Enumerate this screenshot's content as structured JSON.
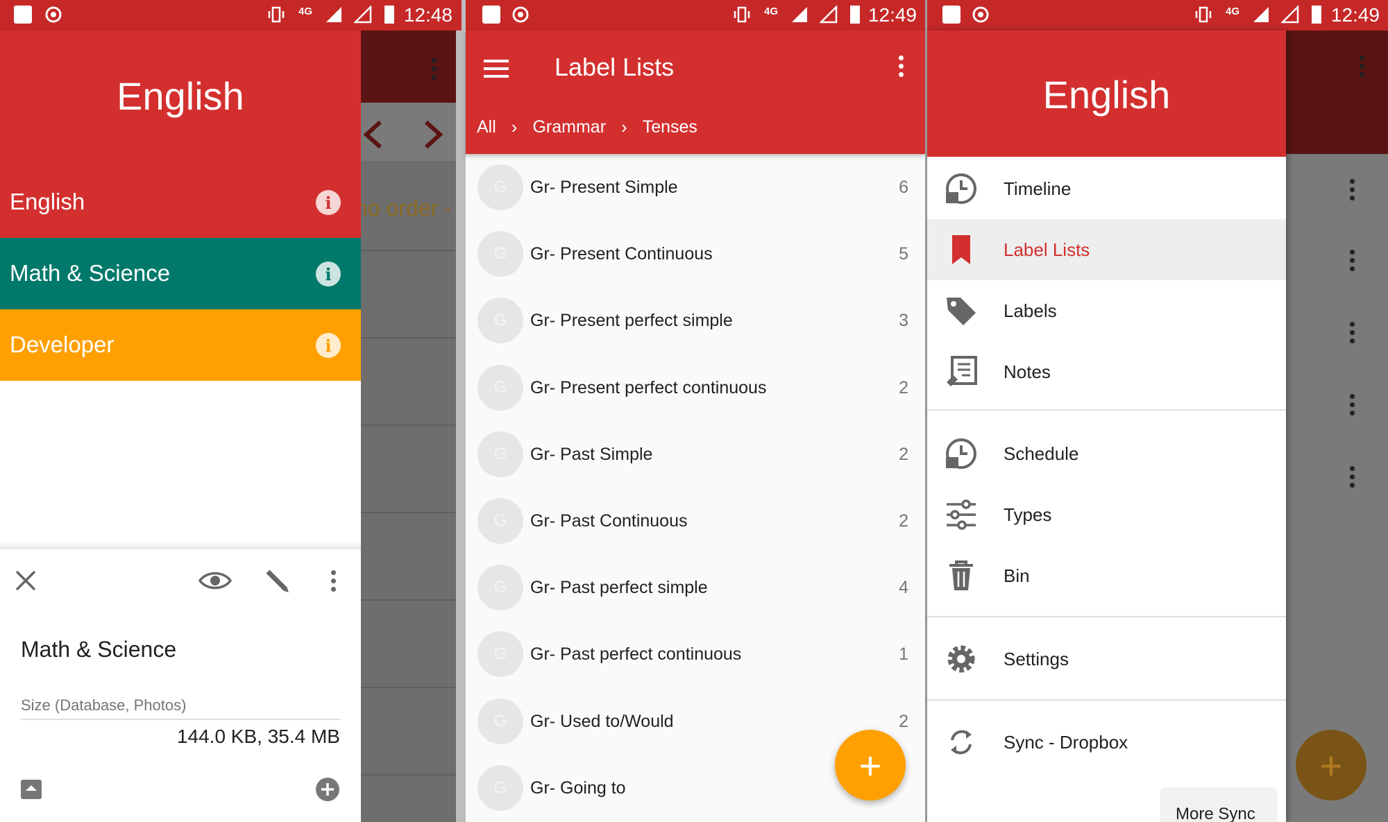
{
  "status_left": {
    "time": "12:48"
  },
  "status_mid": {
    "time": "12:49"
  },
  "status_right": {
    "time": "12:49"
  },
  "panel1": {
    "header_title": "English",
    "behind_text": "no order -",
    "collections": [
      {
        "label": "English",
        "color": "#d32f2f"
      },
      {
        "label": "Math & Science",
        "color": "#00796b"
      },
      {
        "label": "Developer",
        "color": "#ffa000"
      }
    ],
    "sheet": {
      "title": "Math & Science",
      "size_label": "Size (Database, Photos)",
      "size_value": "144.0 KB, 35.4 MB"
    }
  },
  "panel2": {
    "title": "Label Lists",
    "breadcrumb": [
      "All",
      "Grammar",
      "Tenses"
    ],
    "items": [
      {
        "avatar": "G",
        "label": "Gr- Present Simple",
        "count": "6"
      },
      {
        "avatar": "G",
        "label": "Gr- Present Continuous",
        "count": "5"
      },
      {
        "avatar": "G",
        "label": "Gr- Present perfect simple",
        "count": "3"
      },
      {
        "avatar": "G",
        "label": "Gr- Present perfect continuous",
        "count": "2"
      },
      {
        "avatar": "G",
        "label": "Gr- Past Simple",
        "count": "2"
      },
      {
        "avatar": "G",
        "label": "Gr- Past Continuous",
        "count": "2"
      },
      {
        "avatar": "G",
        "label": "Gr- Past perfect simple",
        "count": "4"
      },
      {
        "avatar": "G",
        "label": "Gr- Past perfect continuous",
        "count": "1"
      },
      {
        "avatar": "G",
        "label": "Gr- Used to/Would",
        "count": "2"
      },
      {
        "avatar": "G",
        "label": "Gr- Going to",
        "count": ""
      }
    ],
    "fab": "+"
  },
  "panel3": {
    "header_title": "English",
    "menu": [
      {
        "label": "Timeline",
        "icon": "timeline-icon"
      },
      {
        "label": "Label Lists",
        "icon": "bookmark-icon"
      },
      {
        "label": "Labels",
        "icon": "tag-icon"
      },
      {
        "label": "Notes",
        "icon": "notes-icon"
      },
      {
        "label": "Schedule",
        "icon": "schedule-icon"
      },
      {
        "label": "Types",
        "icon": "sliders-icon"
      },
      {
        "label": "Bin",
        "icon": "trash-icon"
      },
      {
        "label": "Settings",
        "icon": "gear-icon"
      },
      {
        "label": "Sync - Dropbox",
        "icon": "sync-icon"
      }
    ],
    "more_sync": "More Sync",
    "fab": "+"
  },
  "colors": {
    "primary": "#d32f2f",
    "primary_dark": "#c62828",
    "teal": "#00796b",
    "amber": "#ffa000",
    "fab": "#ffa000"
  }
}
